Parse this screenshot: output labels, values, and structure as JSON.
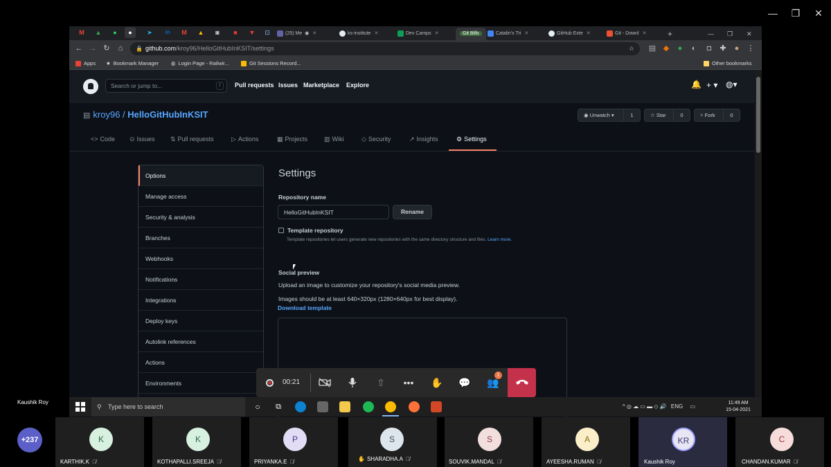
{
  "window": {
    "minimize": "—",
    "restore": "❐",
    "close": "✕"
  },
  "browser": {
    "tabs": [
      {
        "label": "(25) Me",
        "color": "#6264a7"
      },
      {
        "label": "ks-institute",
        "color": "#e6edf3"
      },
      {
        "label": "Dev Camps",
        "color": "#0f9d58"
      },
      {
        "label": "Git Bills",
        "color": "#8fbc8f"
      },
      {
        "label": "Catalin's Tri",
        "color": "#4285f4"
      },
      {
        "label": "GitHub Exte",
        "color": "#e6edf3"
      },
      {
        "label": "Git - Downl",
        "color": "#f05032"
      }
    ],
    "new_tab": "+",
    "url_host": "github.com",
    "url_path": "/kroy96/HelloGitHubInKSIT/settings",
    "bookmarks": [
      "Apps",
      "Bookmark Manager",
      "Login Page - Railwir...",
      "Git Sessions Record..."
    ],
    "other_bookmarks": "Other bookmarks"
  },
  "github": {
    "search_placeholder": "Search or jump to...",
    "search_key": "/",
    "nav": [
      "Pull requests",
      "Issues",
      "Marketplace",
      "Explore"
    ],
    "repo_owner": "kroy96",
    "repo_sep": " / ",
    "repo_name": "HelloGitHubInKSIT",
    "watch_label": "Unwatch ▾",
    "watch_count": "1",
    "star_label": "Star",
    "star_count": "0",
    "fork_label": "Fork",
    "fork_count": "0",
    "repo_tabs": [
      {
        "icon": "<>",
        "label": "Code"
      },
      {
        "icon": "⊙",
        "label": "Issues"
      },
      {
        "icon": "⇅",
        "label": "Pull requests"
      },
      {
        "icon": "▷",
        "label": "Actions"
      },
      {
        "icon": "▦",
        "label": "Projects"
      },
      {
        "icon": "▥",
        "label": "Wiki"
      },
      {
        "icon": "◇",
        "label": "Security"
      },
      {
        "icon": "↗",
        "label": "Insights"
      },
      {
        "icon": "⚙",
        "label": "Settings"
      }
    ],
    "sidebar": [
      "Options",
      "Manage access",
      "Security & analysis",
      "Branches",
      "Webhooks",
      "Notifications",
      "Integrations",
      "Deploy keys",
      "Autolink references",
      "Actions",
      "Environments"
    ],
    "settings_title": "Settings",
    "repo_name_label": "Repository name",
    "repo_name_value": "HelloGitHubInKSIT",
    "rename_label": "Rename",
    "template_label": "Template repository",
    "template_help": "Template repositories let users generate new repositories with the same directory structure and files.",
    "learn_more": "Learn more.",
    "social_title": "Social preview",
    "social_desc": "Upload an image to customize your repository's social media preview.",
    "social_size": "Images should be at least 640×320px (1280×640px for best display).",
    "download_template": "Download template"
  },
  "taskbar": {
    "search_placeholder": "Type here to search",
    "lang": "ENG",
    "time": "11:49 AM",
    "date": "15-04-2021"
  },
  "meeting": {
    "timer": "00:21",
    "people_badge": "1",
    "presenter": "Kaushik Roy",
    "overflow": "+237",
    "participants": [
      {
        "initial": "K",
        "name": "KARTHIK.K",
        "bg": "#d7f0df",
        "fg": "#286b40"
      },
      {
        "initial": "K",
        "name": "KOTHAPALLI.SREEJA",
        "bg": "#d7f0df",
        "fg": "#286b40"
      },
      {
        "initial": "P",
        "name": "PRIYANKA.E",
        "bg": "#e2dcf5",
        "fg": "#4a3d8c"
      },
      {
        "initial": "S",
        "name": "SHARADHA.A",
        "bg": "#dde6ec",
        "fg": "#3d4f5a"
      },
      {
        "initial": "S",
        "name": "SOUVIK.MANDAL",
        "bg": "#f3dede",
        "fg": "#8b3a3a"
      },
      {
        "initial": "A",
        "name": "AYEESHA.RUMAN",
        "bg": "#faefc9",
        "fg": "#8a6d10"
      },
      {
        "initial": "KR",
        "name": "Kaushik Roy",
        "bg": "#e8e6f5",
        "fg": "#3b3a6b"
      },
      {
        "initial": "C",
        "name": "CHANDAN.KUMAR",
        "bg": "#f7dcdc",
        "fg": "#9b3434"
      }
    ]
  }
}
